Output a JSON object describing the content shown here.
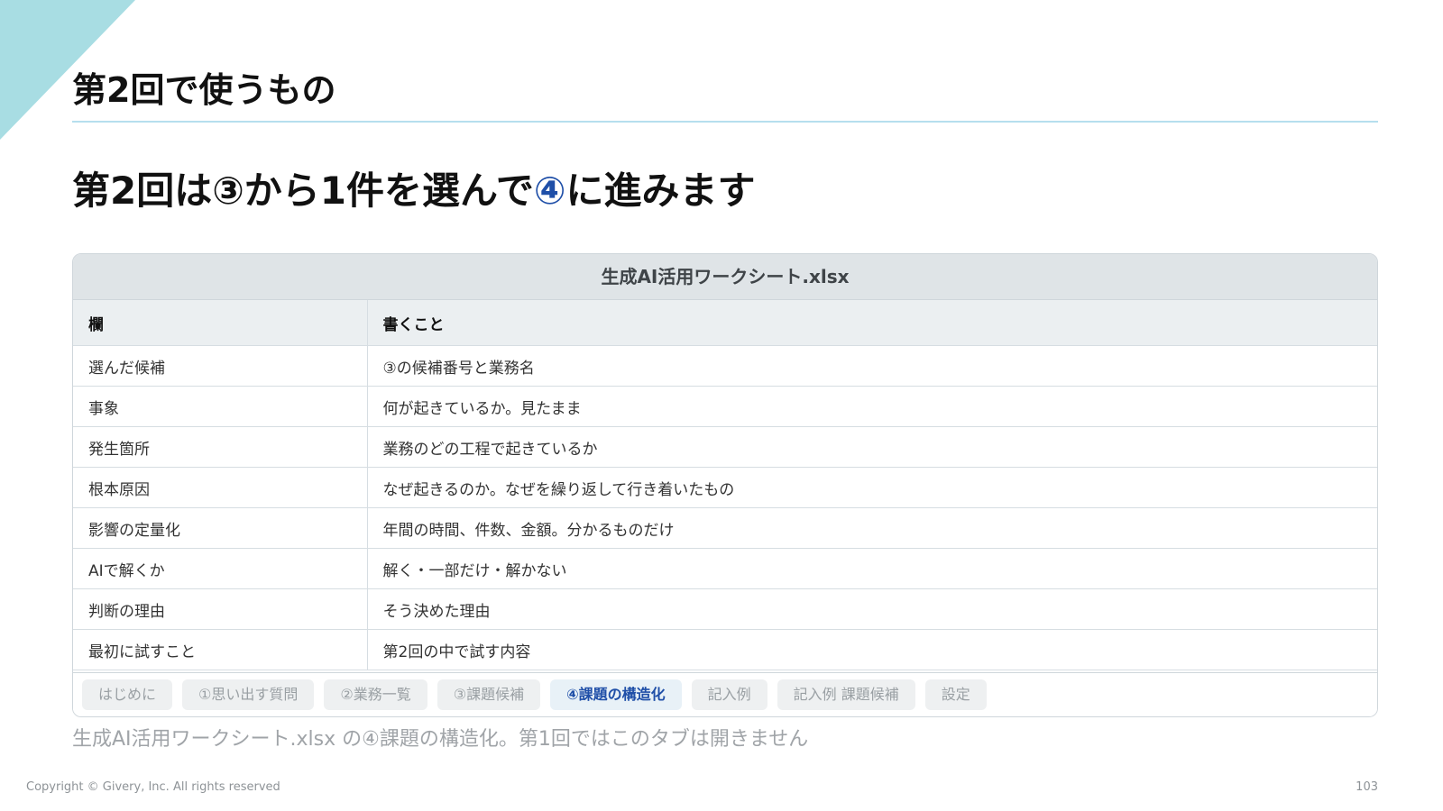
{
  "slide": {
    "title": "第2回で使うもの",
    "headline": {
      "part1": "第2回は③から1件を選んで",
      "accent": "④",
      "part2": "に進みます"
    },
    "caption": "生成AI活用ワークシート.xlsx の④課題の構造化。第1回ではこのタブは開きません",
    "copyright": "Copyright © Givery, Inc. All rights reserved",
    "page_number": "103",
    "colors": {
      "accent": "#1f4fa8",
      "corner": "#a8dde3",
      "rule": "#b6dfee"
    }
  },
  "sheet": {
    "filename": "生成AI活用ワークシート.xlsx",
    "headers": [
      "欄",
      "書くこと"
    ],
    "rows": [
      [
        "選んだ候補",
        "③の候補番号と業務名"
      ],
      [
        "事象",
        "何が起きているか。見たまま"
      ],
      [
        "発生箇所",
        "業務のどの工程で起きているか"
      ],
      [
        "根本原因",
        "なぜ起きるのか。なぜを繰り返して行き着いたもの"
      ],
      [
        "影響の定量化",
        "年間の時間、件数、金額。分かるものだけ"
      ],
      [
        "AIで解くか",
        "解く・一部だけ・解かない"
      ],
      [
        "判断の理由",
        "そう決めた理由"
      ],
      [
        "最初に試すこと",
        "第2回の中で試す内容"
      ]
    ],
    "tabs": [
      {
        "label": "はじめに",
        "active": false
      },
      {
        "label": "①思い出す質問",
        "active": false
      },
      {
        "label": "②業務一覧",
        "active": false
      },
      {
        "label": "③課題候補",
        "active": false
      },
      {
        "label": "④課題の構造化",
        "active": true
      },
      {
        "label": "記入例",
        "active": false
      },
      {
        "label": "記入例 課題候補",
        "active": false
      },
      {
        "label": "設定",
        "active": false
      }
    ]
  }
}
